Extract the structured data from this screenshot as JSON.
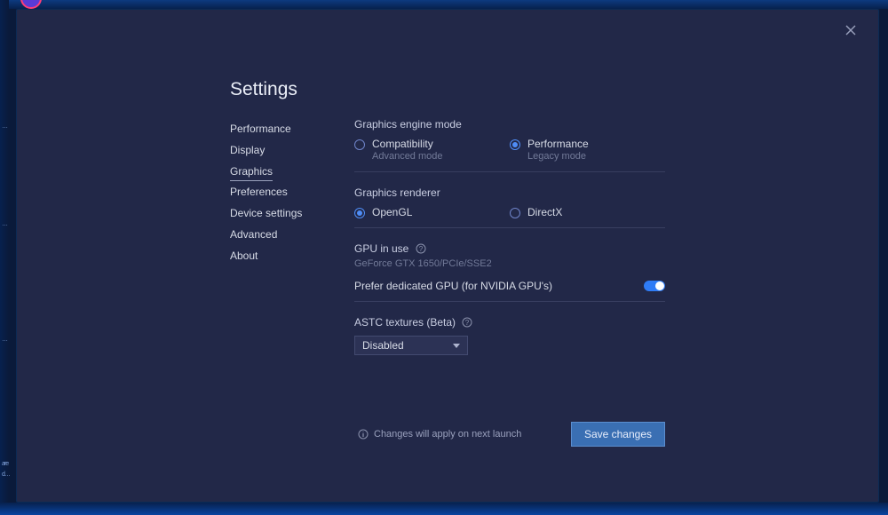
{
  "page": {
    "title": "Settings"
  },
  "sidebar": {
    "items": [
      {
        "label": "Performance"
      },
      {
        "label": "Display"
      },
      {
        "label": "Graphics",
        "active": true
      },
      {
        "label": "Preferences"
      },
      {
        "label": "Device settings"
      },
      {
        "label": "Advanced"
      },
      {
        "label": "About"
      }
    ]
  },
  "graphics": {
    "engine_mode": {
      "label": "Graphics engine mode",
      "options": [
        {
          "label": "Compatibility",
          "sublabel": "Advanced mode",
          "selected": false
        },
        {
          "label": "Performance",
          "sublabel": "Legacy mode",
          "selected": true
        }
      ]
    },
    "renderer": {
      "label": "Graphics renderer",
      "options": [
        {
          "label": "OpenGL",
          "selected": true
        },
        {
          "label": "DirectX",
          "selected": false
        }
      ]
    },
    "gpu": {
      "label": "GPU in use",
      "name": "GeForce GTX 1650/PCIe/SSE2",
      "prefer_dedicated_label": "Prefer dedicated GPU (for NVIDIA GPU's)",
      "prefer_dedicated_on": true
    },
    "astc": {
      "label": "ASTC textures (Beta)",
      "selected": "Disabled"
    }
  },
  "footer": {
    "note": "Changes will apply on next launch",
    "save_label": "Save changes"
  }
}
